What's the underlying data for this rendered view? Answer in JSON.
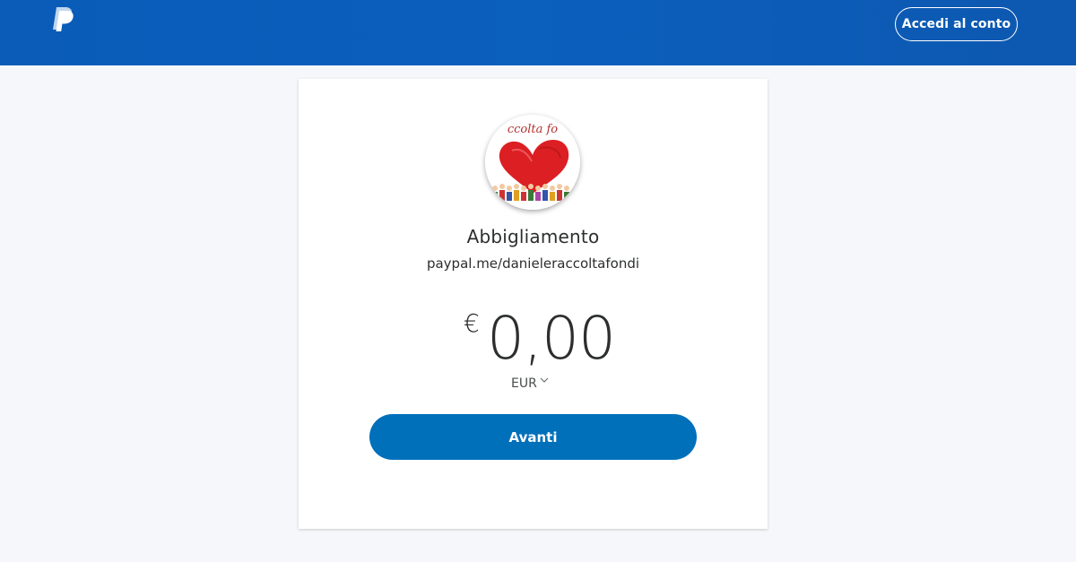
{
  "header": {
    "brand_icon": "paypal-logo-icon",
    "login_label": "Accedi al conto"
  },
  "profile": {
    "avatar_text": "ccolta fo",
    "name": "Abbigliamento",
    "link": "paypal.me/danieleraccoltafondi"
  },
  "payment": {
    "currency_symbol": "€",
    "amount": "0,00",
    "currency_code": "EUR",
    "currency_icon": "chevron-down-icon",
    "submit_label": "Avanti"
  },
  "colors": {
    "header_blue": "#0b5fbd",
    "button_blue": "#0070ba",
    "page_bg": "#f5f7fa",
    "text": "#2c2e2f"
  }
}
